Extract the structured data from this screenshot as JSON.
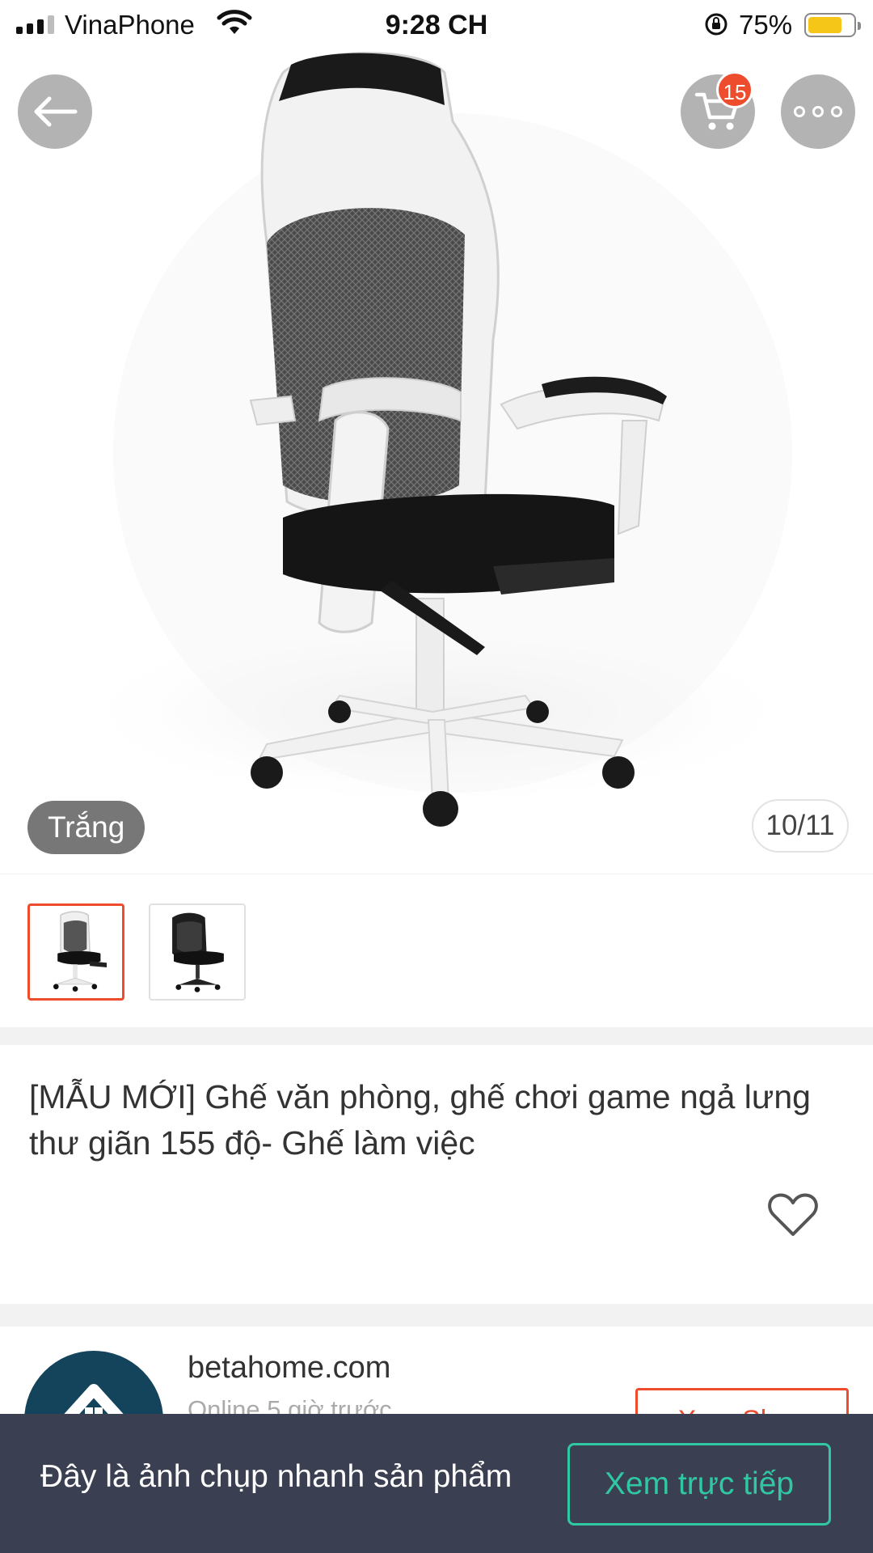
{
  "status_bar": {
    "carrier": "VinaPhone",
    "time": "9:28 CH",
    "battery_percent": "75%",
    "battery_level": 0.75
  },
  "top_actions": {
    "cart_badge": "15"
  },
  "gallery": {
    "variant_label": "Trắng",
    "page_counter": "10/11",
    "thumbnails": [
      {
        "variant": "white",
        "selected": true
      },
      {
        "variant": "black",
        "selected": false
      }
    ]
  },
  "product": {
    "title": "[MẪU MỚI] Ghế văn phòng, ghế chơi game ngả lưng thư giãn 155 độ- Ghế làm việc"
  },
  "shop": {
    "name": "betahome.com",
    "status": "Online 5 giờ trước",
    "view_shop_label": "Xem Shop"
  },
  "snapshot_banner": {
    "message": "Đây là ảnh chụp nhanh sản phẩm",
    "live_button_label": "Xem trực tiếp"
  },
  "colors": {
    "accent": "#ee4d2d",
    "banner_bg": "#3b3f52",
    "banner_button": "#30c8a2",
    "battery": "#f5c518",
    "shop_avatar": "#14445c"
  }
}
